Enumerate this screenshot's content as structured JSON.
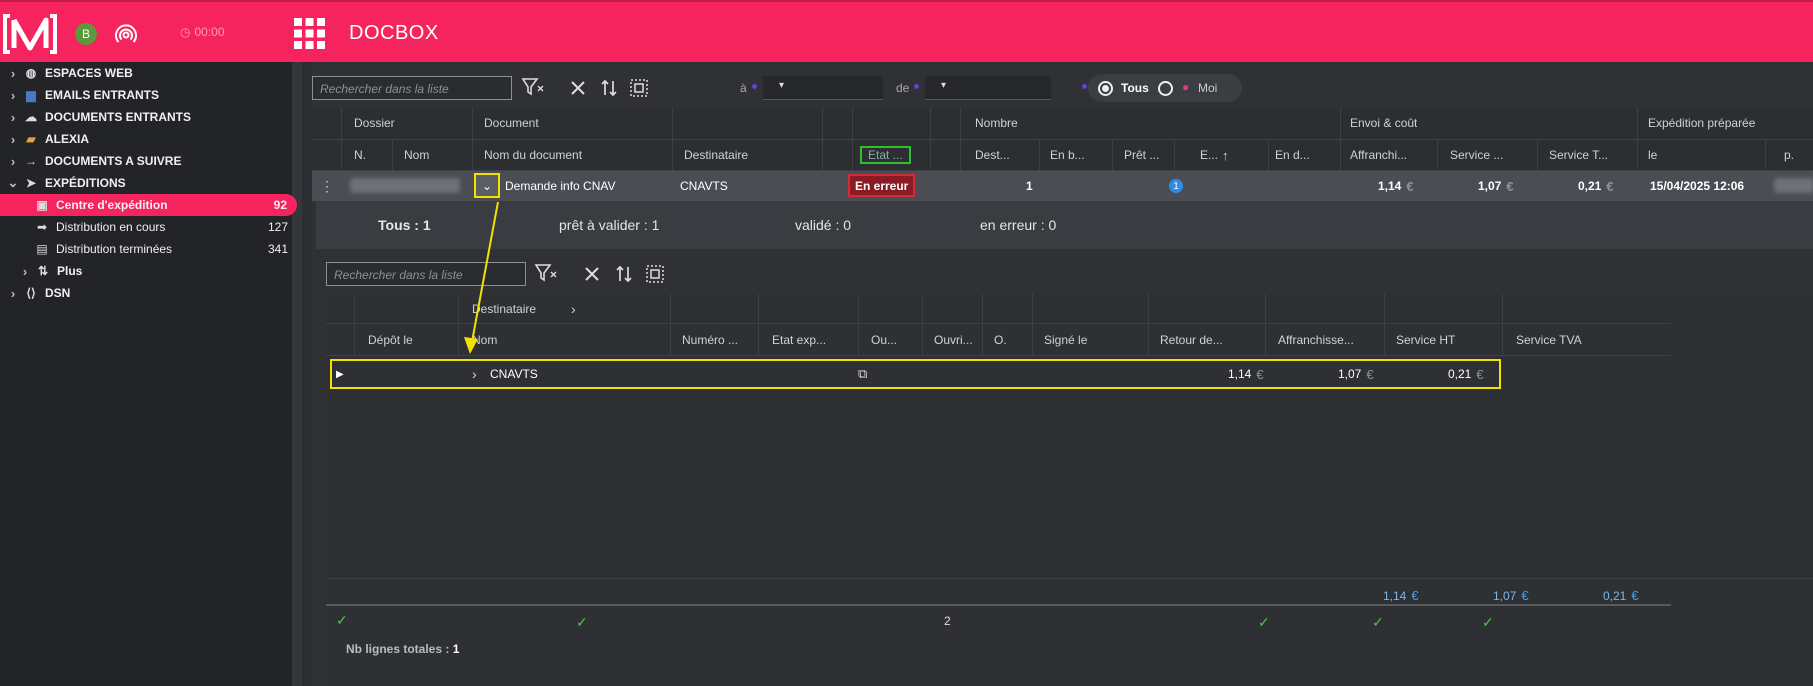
{
  "app": {
    "title": "DOCBOX",
    "avatar_letter": "B",
    "timer": "00:00"
  },
  "colors": {
    "brand": "#f5245f",
    "highlight": "#f2e200",
    "ok": "#4cc24c",
    "error": "#c61f2f",
    "info": "#4d9be8"
  },
  "sidebar": {
    "items": [
      {
        "label": "ESPACES WEB",
        "icon": "globe-icon"
      },
      {
        "label": "EMAILS ENTRANTS",
        "icon": "inbox-icon"
      },
      {
        "label": "DOCUMENTS ENTRANTS",
        "icon": "cloud-download-icon"
      },
      {
        "label": "ALEXIA",
        "icon": "folder-icon"
      },
      {
        "label": "DOCUMENTS A SUIVRE",
        "icon": "arrow-right-icon"
      },
      {
        "label": "EXPÉDITIONS",
        "icon": "send-icon"
      },
      {
        "label": "Centre d'expédition",
        "count": "92",
        "icon": "mailbox-icon"
      },
      {
        "label": "Distribution en cours",
        "count": "127",
        "icon": "truck-arrow-icon"
      },
      {
        "label": "Distribution terminées",
        "count": "341",
        "icon": "archive-icon"
      },
      {
        "label": "Plus",
        "icon": "sort-icon"
      },
      {
        "label": "DSN",
        "icon": "code-icon"
      }
    ]
  },
  "toolbar": {
    "search_placeholder": "Rechercher dans la liste",
    "to_label": "à",
    "from_label": "de",
    "scope_all": "Tous",
    "scope_me": "Moi"
  },
  "table": {
    "groups": [
      "Dossier",
      "Document",
      "Nombre",
      "Envoi & coût",
      "Expédition préparée"
    ],
    "columns": [
      "N.",
      "Nom",
      "Nom du document",
      "Destinataire",
      "Etat ...",
      "Dest...",
      "En b...",
      "Prêt ...",
      "E...",
      "En d...",
      "Affranchi...",
      "Service ...",
      "Service T...",
      "le",
      "p."
    ],
    "row": {
      "document": "Demande info CNAV",
      "recipient": "CNAVTS",
      "status": "En erreur",
      "dest_count": "1",
      "ready_badge": "1",
      "postage": "1,14",
      "service": "1,07",
      "tax": "0,21",
      "prepared_date": "15/04/2025 12:06",
      "currency": "€"
    }
  },
  "summary": {
    "all": "Tous : 1",
    "ready": "prêt à valider : 1",
    "validated": "validé : 0",
    "error": "en erreur : 0"
  },
  "subtable": {
    "search_placeholder": "Rechercher dans la liste",
    "group": "Destinataire",
    "columns": [
      "Dépôt le",
      "Nom",
      "Numéro ...",
      "Etat exp...",
      "Ou...",
      "Ouvri...",
      "O.",
      "Signé le",
      "Retour de...",
      "Affranchisse...",
      "Service HT",
      "Service TVA"
    ],
    "row": {
      "name": "CNAVTS",
      "postage": "1,14",
      "service": "1,07",
      "tax": "0,21"
    },
    "totals": {
      "postage": "1,14",
      "service": "1,07",
      "tax": "0,21",
      "count": "2"
    },
    "footer_label": "Nb lignes totales :",
    "footer_value": "1"
  }
}
